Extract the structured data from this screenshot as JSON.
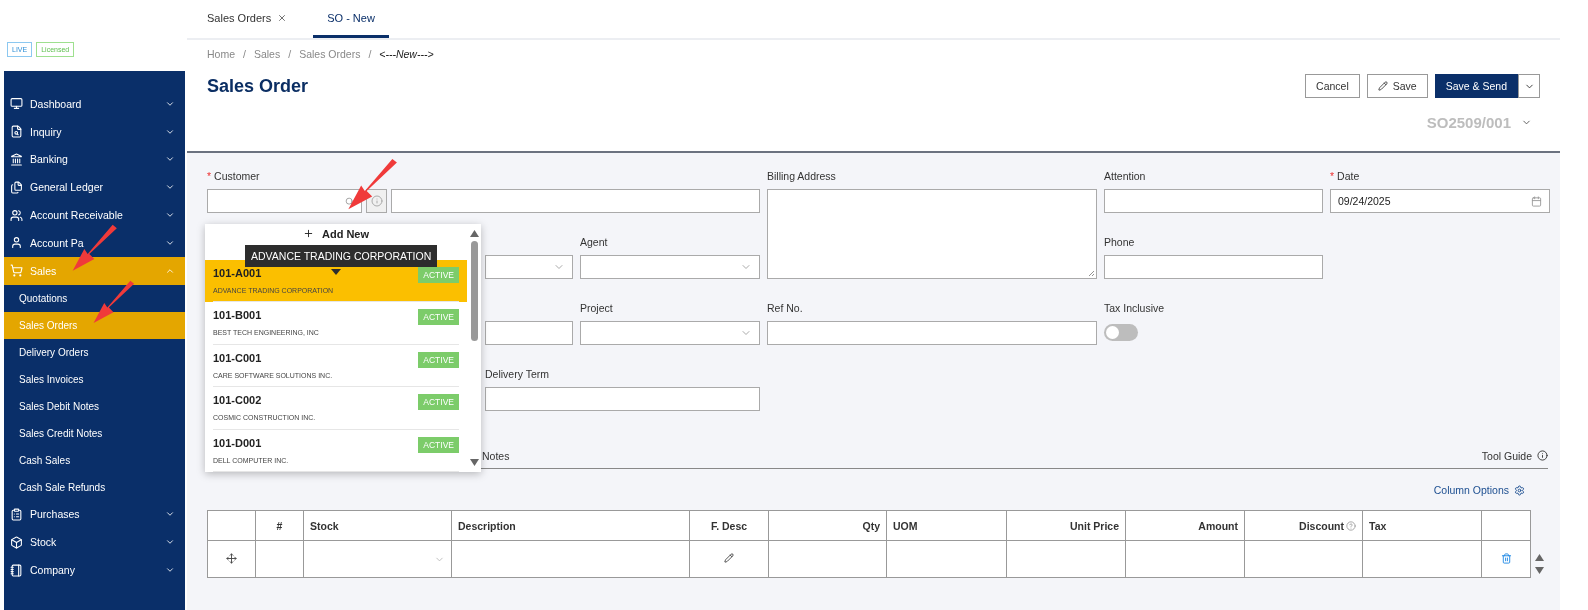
{
  "sidebar": {
    "badges": [
      {
        "label": "LIVE",
        "kind": "live"
      },
      {
        "label": "Licensed",
        "kind": "licensed"
      }
    ],
    "items": [
      {
        "label": "Dashboard",
        "expanded": false,
        "selected": false
      },
      {
        "label": "Inquiry",
        "expanded": false,
        "selected": false
      },
      {
        "label": "Banking",
        "expanded": false,
        "selected": false
      },
      {
        "label": "General Ledger",
        "expanded": false,
        "selected": false
      },
      {
        "label": "Account Receivable",
        "expanded": false,
        "selected": false
      },
      {
        "label": "Account Pa",
        "expanded": false,
        "selected": false
      },
      {
        "label": "Sales",
        "expanded": true,
        "selected": true,
        "children": [
          {
            "label": "Quotations",
            "selected": false
          },
          {
            "label": "Sales Orders",
            "selected": true
          },
          {
            "label": "Delivery Orders",
            "selected": false
          },
          {
            "label": "Sales Invoices",
            "selected": false
          },
          {
            "label": "Sales Debit Notes",
            "selected": false
          },
          {
            "label": "Sales Credit Notes",
            "selected": false
          },
          {
            "label": "Cash Sales",
            "selected": false
          },
          {
            "label": "Cash Sale Refunds",
            "selected": false
          }
        ]
      },
      {
        "label": "Purchases",
        "expanded": false,
        "selected": false
      },
      {
        "label": "Stock",
        "expanded": false,
        "selected": false
      },
      {
        "label": "Company",
        "expanded": false,
        "selected": false
      }
    ]
  },
  "tabs": [
    {
      "label": "Sales Orders",
      "selected": false,
      "closable": true
    },
    {
      "label": "SO - New",
      "selected": true,
      "closable": false
    }
  ],
  "breadcrumb": {
    "separator": "/",
    "items": [
      "Home",
      "Sales",
      "Sales Orders",
      "<---New--->"
    ]
  },
  "title": "Sales Order",
  "actions": [
    {
      "label": "Cancel",
      "kind": "plain"
    },
    {
      "label": "Save",
      "kind": "edit"
    },
    {
      "label": "Save & Send",
      "kind": "primary"
    }
  ],
  "document_number": "SO2509/001",
  "form": {
    "required_mark": "*",
    "customer": {
      "label": "Customer",
      "required": true
    },
    "billing_address": {
      "label": "Billing Address"
    },
    "attention": {
      "label": "Attention"
    },
    "date": {
      "label": "Date",
      "required": true,
      "value": "09/24/2025"
    },
    "agent": {
      "label": "Agent"
    },
    "phone": {
      "label": "Phone"
    },
    "project": {
      "label": "Project"
    },
    "ref_no": {
      "label": "Ref No."
    },
    "tax_inclusive": {
      "label": "Tax Inclusive",
      "on": false
    },
    "delivery_term": {
      "label": "Delivery Term"
    }
  },
  "customer_dropdown": {
    "add_new": "Add New",
    "tooltip": "ADVANCE TRADING CORPORATION",
    "items": [
      {
        "code": "101-A001",
        "name": "ADVANCE TRADING CORPORATION",
        "status": "ACTIVE",
        "selected": true
      },
      {
        "code": "101-B001",
        "name": "BEST TECH ENGINEERING, INC",
        "status": "ACTIVE",
        "selected": false
      },
      {
        "code": "101-C001",
        "name": "CARE SOFTWARE SOLUTIONS INC.",
        "status": "ACTIVE",
        "selected": false
      },
      {
        "code": "101-C002",
        "name": "COSMIC CONSTRUCTION INC.",
        "status": "ACTIVE",
        "selected": false
      },
      {
        "code": "101-D001",
        "name": "DELL COMPUTER INC.",
        "status": "ACTIVE",
        "selected": false
      }
    ]
  },
  "section_tab": "Notes",
  "tool_guide": "Tool Guide",
  "column_options": "Column Options",
  "table": {
    "columns": [
      {
        "label": "#",
        "kind": "center"
      },
      {
        "label": "Stock",
        "kind": "select"
      },
      {
        "label": "Description",
        "kind": "text"
      },
      {
        "label": "F. Desc",
        "kind": "edit"
      },
      {
        "label": "Qty",
        "kind": "number"
      },
      {
        "label": "UOM",
        "kind": "text"
      },
      {
        "label": "Unit Price",
        "kind": "number"
      },
      {
        "label": "Amount",
        "kind": "number"
      },
      {
        "label": "Discount",
        "kind": "number",
        "help": true
      },
      {
        "label": "Tax",
        "kind": "text"
      }
    ]
  }
}
